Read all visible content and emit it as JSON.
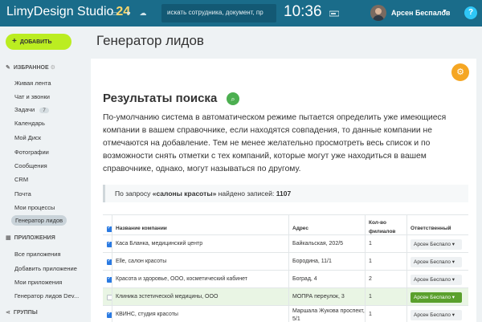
{
  "header": {
    "brand": "LimyDesign Studio",
    "brand_number": "24",
    "search_placeholder": "искать сотрудника, документ, пр",
    "time": "10:36",
    "user_name": "Арсен Беспалов",
    "help": "?"
  },
  "sidebar": {
    "add_button": "ДОБАВИТЬ",
    "favorites_title": "ИЗБРАННОЕ",
    "favorites": [
      {
        "label": "Живая лента"
      },
      {
        "label": "Чат и звонки"
      },
      {
        "label": "Задачи",
        "badge": "7"
      },
      {
        "label": "Календарь"
      },
      {
        "label": "Мой Диск"
      },
      {
        "label": "Фотографии"
      },
      {
        "label": "Сообщения"
      },
      {
        "label": "CRM"
      },
      {
        "label": "Почта"
      },
      {
        "label": "Мои процессы"
      },
      {
        "label": "Генератор лидов"
      }
    ],
    "apps_title": "ПРИЛОЖЕНИЯ",
    "apps": [
      {
        "label": "Все приложения"
      },
      {
        "label": "Добавить приложение"
      },
      {
        "label": "Мои приложения"
      },
      {
        "label": "Генератор лидов Dev..."
      }
    ],
    "groups_title": "ГРУППЫ"
  },
  "main": {
    "page_title": "Генератор лидов",
    "results_title": "Результаты поиска",
    "description": "По-умолчанию система в автоматическом режиме пытается определить уже имеющиеся компании в вашем справочнике, если находятся совпадения, то данные компании не отмечаются на добавление. Тем не менее желательно просмотреть весь список и по возможности снять отметки с тех компаний, которые могут уже находиться в вашем справочнике, однако, могут называться по другому.",
    "query_prefix": "По запросу ",
    "query_term": "«салоны красоты»",
    "query_middle": " найдено записей: ",
    "query_count": "1107"
  },
  "table": {
    "headers": {
      "name": "Название компании",
      "address": "Адрес",
      "branches_line1": "Кол-во",
      "branches_line2": "филиалов",
      "responsible": "Ответственный"
    },
    "rows": [
      {
        "checked": true,
        "name": "Каса Бланка, медицинский центр",
        "address": "Байкальская, 202/5",
        "address2": "",
        "branches": "1",
        "responsible": "Арсен Беспало",
        "highlight": false
      },
      {
        "checked": true,
        "name": "Elle, салон красоты",
        "address": "Бородина, 11/1",
        "address2": "",
        "branches": "1",
        "responsible": "Арсен Беспало",
        "highlight": false
      },
      {
        "checked": true,
        "name": "Красота и здоровье, ООО, косметический кабинет",
        "address": "Боград, 4",
        "address2": "",
        "branches": "2",
        "responsible": "Арсен Беспало",
        "highlight": false
      },
      {
        "checked": false,
        "name": "Клиника эстетической медицины, ООО",
        "address": "МОПРА переулок, 3",
        "address2": "",
        "branches": "1",
        "responsible": "Арсен Беспало",
        "highlight": true
      },
      {
        "checked": true,
        "name": "КВИНС, студия красоты",
        "address": "Маршала Жукова проспект,",
        "address2": "5/1",
        "branches": "1",
        "responsible": "Арсен Беспало",
        "highlight": false
      }
    ]
  },
  "colors": {
    "header_bg": "#1a6c8a",
    "add_button": "#bbed21",
    "accent_green": "#5aa02c",
    "gear_orange": "#f5a623",
    "checkbox_blue": "#2a7ae2"
  }
}
